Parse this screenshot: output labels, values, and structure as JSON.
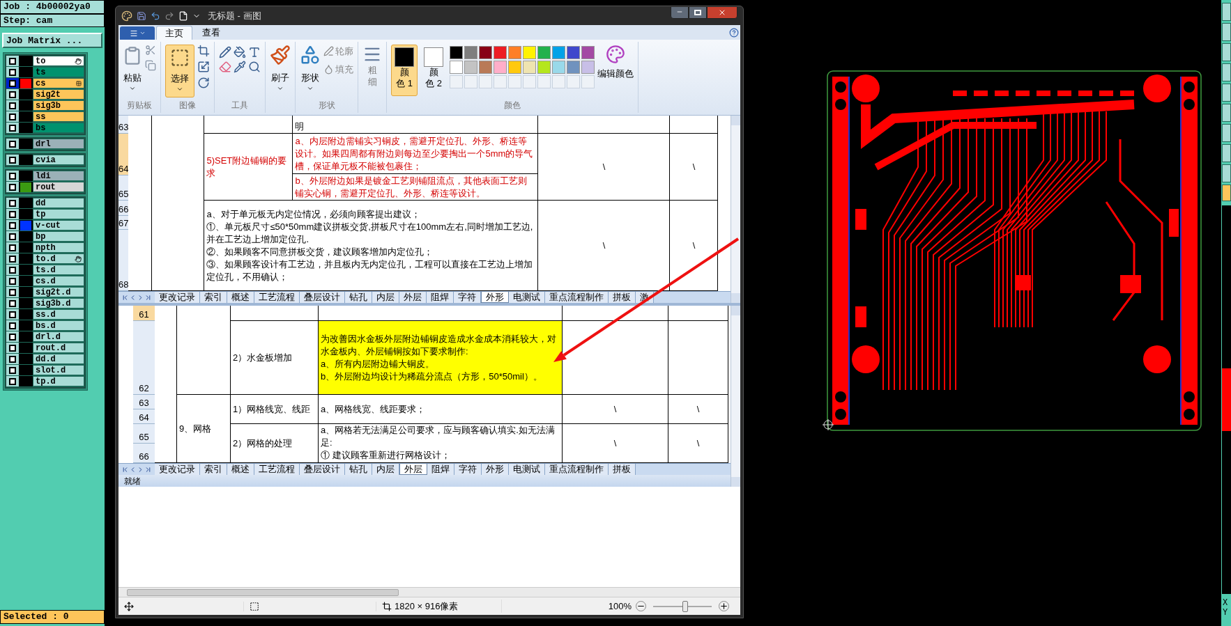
{
  "cam_panel": {
    "job": "Job : 4b00002ya0",
    "step": "Step: cam",
    "matrix_button": "Job Matrix ...",
    "layer_groups": [
      [
        {
          "name": "to",
          "color": "#ffffff",
          "active": false,
          "kind": "hand"
        },
        {
          "name": "ts",
          "color": "#00926e",
          "active": false,
          "kind": "plain"
        },
        {
          "name": "cs",
          "color": "#fdc55a",
          "active": true,
          "kind": "grid",
          "swatch": {
            "color": "#ff0000"
          }
        },
        {
          "name": "sig2t",
          "color": "#fdc55a",
          "active": false,
          "kind": "plain"
        },
        {
          "name": "sig3b",
          "color": "#fdc55a",
          "active": false,
          "kind": "plain"
        },
        {
          "name": "ss",
          "color": "#fdc55a",
          "active": false,
          "kind": "plain"
        },
        {
          "name": "bs",
          "color": "#00926e",
          "active": false,
          "kind": "plain"
        }
      ],
      [
        {
          "name": "drl",
          "color": "#9bb1b8",
          "active": false,
          "kind": "plain"
        }
      ],
      [
        {
          "name": "cvia",
          "color": "#a8dcd6",
          "active": false,
          "kind": "plain"
        }
      ],
      [
        {
          "name": "ldi",
          "color": "#9bb1b8",
          "active": false,
          "kind": "plain"
        },
        {
          "name": "rout",
          "color": "#d6d6d6",
          "active": false,
          "kind": "plain",
          "swatch": {
            "color": "#3b9a12"
          }
        }
      ],
      [
        {
          "name": "dd",
          "color": "#a8dcd6",
          "active": false,
          "kind": "plain"
        },
        {
          "name": "tp",
          "color": "#a8dcd6",
          "active": false,
          "kind": "plain"
        },
        {
          "name": "v-cut",
          "color": "#a8dcd6",
          "active": false,
          "kind": "plain",
          "swatch": {
            "color": "#0033ff"
          }
        },
        {
          "name": "bp",
          "color": "#a8dcd6",
          "active": false,
          "kind": "plain"
        },
        {
          "name": "npth",
          "color": "#a8dcd6",
          "active": false,
          "kind": "plain"
        },
        {
          "name": "to.d",
          "color": "#a8dcd6",
          "active": false,
          "kind": "hand"
        },
        {
          "name": "ts.d",
          "color": "#a8dcd6",
          "active": false,
          "kind": "plain"
        },
        {
          "name": "cs.d",
          "color": "#a8dcd6",
          "active": false,
          "kind": "plain"
        },
        {
          "name": "sig2t.d",
          "color": "#a8dcd6",
          "active": false,
          "kind": "plain"
        },
        {
          "name": "sig3b.d",
          "color": "#a8dcd6",
          "active": false,
          "kind": "plain"
        },
        {
          "name": "ss.d",
          "color": "#a8dcd6",
          "active": false,
          "kind": "plain"
        },
        {
          "name": "bs.d",
          "color": "#a8dcd6",
          "active": false,
          "kind": "plain"
        },
        {
          "name": "drl.d",
          "color": "#a8dcd6",
          "active": false,
          "kind": "plain"
        },
        {
          "name": "rout.d",
          "color": "#a8dcd6",
          "active": false,
          "kind": "plain"
        },
        {
          "name": "dd.d",
          "color": "#a8dcd6",
          "active": false,
          "kind": "plain"
        },
        {
          "name": "slot.d",
          "color": "#a8dcd6",
          "active": false,
          "kind": "plain"
        },
        {
          "name": "tp.d",
          "color": "#a8dcd6",
          "active": false,
          "kind": "plain"
        }
      ]
    ],
    "selected_count": "Selected : 0"
  },
  "paint": {
    "title": "无标题 - 画图",
    "tabs": [
      {
        "label": "主页",
        "selected": true
      },
      {
        "label": "查看",
        "selected": false
      }
    ],
    "ribbon": {
      "paste": "粘贴",
      "clipboard_group": "剪贴板",
      "select": "选择",
      "image_group": "图像",
      "tools_group": "工具",
      "brushes": "刷子",
      "shapes": "形状",
      "outline": "轮廓",
      "fill": "填充",
      "shapes_group": "形状",
      "size": [
        "粗",
        "细"
      ],
      "color1": {
        "lines": [
          "颜",
          "色 1"
        ],
        "selected": true,
        "color": "#000000"
      },
      "color2": {
        "lines": [
          "颜",
          "色 2"
        ],
        "selected": false,
        "color": "#ffffff"
      },
      "palette": [
        {
          "kind": "color",
          "color": "#000000"
        },
        {
          "kind": "color",
          "color": "#7f7f7f"
        },
        {
          "kind": "color",
          "color": "#880015"
        },
        {
          "kind": "color",
          "color": "#ed1c24"
        },
        {
          "kind": "color",
          "color": "#ff7f27"
        },
        {
          "kind": "color",
          "color": "#fff200"
        },
        {
          "kind": "color",
          "color": "#22b14c"
        },
        {
          "kind": "color",
          "color": "#00a2e8"
        },
        {
          "kind": "color",
          "color": "#3f48cc"
        },
        {
          "kind": "color",
          "color": "#a349a4"
        },
        {
          "kind": "color",
          "color": "#ffffff"
        },
        {
          "kind": "color",
          "color": "#c3c3c3"
        },
        {
          "kind": "color",
          "color": "#b97a57"
        },
        {
          "kind": "color",
          "color": "#ffaec9"
        },
        {
          "kind": "color",
          "color": "#ffc90e"
        },
        {
          "kind": "color",
          "color": "#efe4b0"
        },
        {
          "kind": "color",
          "color": "#b5e61d"
        },
        {
          "kind": "color",
          "color": "#99d9ea"
        },
        {
          "kind": "color",
          "color": "#7092be"
        },
        {
          "kind": "color",
          "color": "#c8bfe7"
        },
        {
          "kind": "empty"
        },
        {
          "kind": "empty"
        },
        {
          "kind": "empty"
        },
        {
          "kind": "empty"
        },
        {
          "kind": "empty"
        },
        {
          "kind": "empty"
        },
        {
          "kind": "empty"
        },
        {
          "kind": "empty"
        },
        {
          "kind": "empty"
        },
        {
          "kind": "empty"
        }
      ],
      "edit_colors": "编辑颜色",
      "colors_group": "颜色"
    },
    "status": {
      "dimensions": "1820 × 916像素",
      "zoom": "100%",
      "zoom_slider": {
        "level": 0.55
      }
    }
  },
  "sheet_upper": {
    "row_headers": [
      {
        "label": "63",
        "selected": false
      },
      {
        "label": "64",
        "selected": true
      },
      {
        "label": "65",
        "selected": false
      },
      {
        "label": "66",
        "selected": false
      },
      {
        "label": "67",
        "selected": false
      },
      {
        "label": "68",
        "selected": false
      }
    ],
    "cells": [
      {
        "text": "明"
      },
      {
        "text": "5)SET附边铺铜的要求",
        "color": "#d40000"
      },
      {
        "text": "a、内层附边需铺实习铜皮，需避开定位孔、外形、桥连等设计。如果四周都有附边则每边至少要掏出一个5mm的导气槽，保证单元板不能被包裹住；",
        "color": "#d40000"
      },
      {
        "text": "b、外层附边如果是镀金工艺则铺阻流点，其他表面工艺则铺实心铜，需避开定位孔、外形、桥连等设计。",
        "color": "#d40000"
      },
      {
        "text": "\\"
      },
      {
        "text": "\\"
      },
      {
        "text": "a、对于单元板无内定位情况，必须向顾客提出建议；\n①、单元板尺寸≤50*50mm建议拼板交货,拼板尺寸在100mm左右,同时增加工艺边,并在工艺边上增加定位孔.\n②、如果顾客不同意拼板交货，建议顾客增加内定位孔；\n③、如果顾客设计有工艺边，并且板内无内定位孔，工程可以直接在工艺边上增加定位孔，不用确认；"
      },
      {
        "text": "\\"
      },
      {
        "text": "\\"
      }
    ],
    "sheet_tabs": [
      {
        "label": "更改记录",
        "selected": false
      },
      {
        "label": "索引",
        "selected": false
      },
      {
        "label": "概述",
        "selected": false
      },
      {
        "label": "工艺流程",
        "selected": false
      },
      {
        "label": "叠层设计",
        "selected": false
      },
      {
        "label": "钻孔",
        "selected": false
      },
      {
        "label": "内层",
        "selected": false
      },
      {
        "label": "外层",
        "selected": false
      },
      {
        "label": "阻焊",
        "selected": false
      },
      {
        "label": "字符",
        "selected": false
      },
      {
        "label": "外形",
        "selected": true
      },
      {
        "label": "电测试",
        "selected": false
      },
      {
        "label": "重点流程制作",
        "selected": false
      },
      {
        "label": "拼板",
        "selected": false
      },
      {
        "label": "激",
        "selected": false
      }
    ]
  },
  "sheet_lower": {
    "row_headers": [
      {
        "label": "61",
        "selected": true
      },
      {
        "label": "62",
        "selected": false
      },
      {
        "label": "63",
        "selected": false
      },
      {
        "label": "64",
        "selected": false
      },
      {
        "label": "65",
        "selected": false
      },
      {
        "label": "66",
        "selected": false
      }
    ],
    "cells": [
      {
        "text": "2）水金板增加"
      },
      {
        "text": "为改善因水金板外层附边铺铜皮造成水金成本消耗较大，对水金板内、外层铺铜按如下要求制作:\na、所有内层附边铺大铜皮。\nb、外层附边均设计为稀疏分流点（方形，50*50mil）。",
        "highlight": {
          "color": "#ffff00"
        }
      },
      {
        "text": "9、网格"
      },
      {
        "text": "1）网格线宽、线距"
      },
      {
        "text": "a、网格线宽、线距要求；"
      },
      {
        "text": "\\"
      },
      {
        "text": "\\"
      },
      {
        "text": "2）网格的处理"
      },
      {
        "text": "a、网格若无法满足公司要求，应与顾客确认填实.如无法满足:\n①  建议顾客重新进行网格设计；"
      },
      {
        "text": "\\"
      },
      {
        "text": "\\"
      }
    ],
    "sheet_tabs": [
      {
        "label": "更改记录",
        "selected": false
      },
      {
        "label": "索引",
        "selected": false
      },
      {
        "label": "概述",
        "selected": false
      },
      {
        "label": "工艺流程",
        "selected": false
      },
      {
        "label": "叠层设计",
        "selected": false
      },
      {
        "label": "钻孔",
        "selected": false
      },
      {
        "label": "内层",
        "selected": false
      },
      {
        "label": "外层",
        "selected": true
      },
      {
        "label": "阻焊",
        "selected": false
      },
      {
        "label": "字符",
        "selected": false
      },
      {
        "label": "外形",
        "selected": false
      },
      {
        "label": "电测试",
        "selected": false
      },
      {
        "label": "重点流程制作",
        "selected": false
      },
      {
        "label": "拼板",
        "selected": false
      }
    ],
    "status": "就绪"
  },
  "coordinate_labels": [
    "X",
    "Y"
  ]
}
